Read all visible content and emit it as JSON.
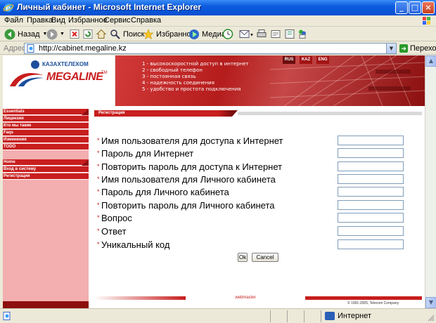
{
  "window": {
    "title": "Личный кабинет - Microsoft Internet Explorer",
    "minimize": "_",
    "maximize": "□",
    "close": "×"
  },
  "menu": [
    "Файл",
    "Правка",
    "Вид",
    "Избранное",
    "Сервис",
    "Справка"
  ],
  "toolbar": {
    "back": "Назад",
    "search": "Поиск",
    "favorites": "Избранное",
    "media": "Медиа"
  },
  "address": {
    "label": "Адрес:",
    "url": "http://cabinet.megaline.kz",
    "go": "Переход"
  },
  "banner": {
    "operator": "КАЗАХТЕЛЕКОМ",
    "brand": "MEGALINE",
    "trademark": "TM",
    "languages": [
      "RUS",
      "KAZ",
      "ENG"
    ],
    "features": [
      "1 - высокоскоростной доступ в интернет",
      "2 - свободный телефон",
      "3 - постоянная связь",
      "4 - надежность соединения",
      "5 - удобство и простота подключения"
    ]
  },
  "sidebar": {
    "group1": [
      "Essentials",
      "Лицензия",
      "Кто мы такие",
      "Faqs",
      "Изменения",
      "TODO"
    ],
    "group2": [
      "Home",
      "Вход в систему",
      "Регистрация"
    ]
  },
  "content": {
    "section_title": "Регистрация",
    "fields": [
      "Имя пользователя для доступа к Интернет",
      "Пароль для Интернет",
      "Повторить пароль для доступа к Интернет",
      "Имя пользователя для Личного кабинета",
      "Пароль для Личного кабинета",
      "Повторить пароль для Личного кабинета",
      "Вопрос",
      "Ответ",
      "Уникальный код"
    ],
    "required_mark": "*",
    "ok_button": "Ok",
    "cancel_button": "Cancel",
    "footer_link": "webmaster",
    "copyright": "© 1991-2005, Telecom Company"
  },
  "status": {
    "zone": "Интернет"
  },
  "colors": {
    "brand_red": "#c81e1e",
    "sidebar_bg": "#f3aeb0",
    "xp_blue": "#0b5ce0"
  }
}
